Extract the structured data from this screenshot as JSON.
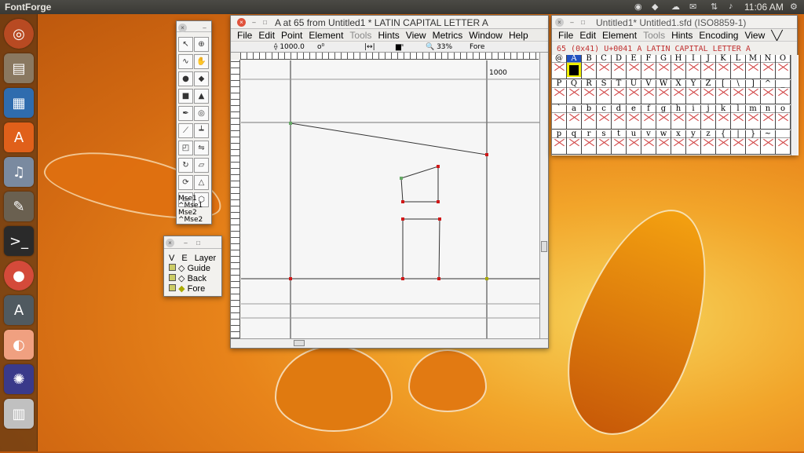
{
  "topbar": {
    "app": "FontForge",
    "clock": "11:06 AM"
  },
  "glyph_window": {
    "title": "A at 65 from Untitled1 * LATIN CAPITAL LETTER A",
    "menu": [
      "File",
      "Edit",
      "Point",
      "Element",
      "Tools",
      "Hints",
      "View",
      "Metrics",
      "Window",
      "Help"
    ],
    "ruler_info": {
      "width": "1000.0",
      "zoom": "33%",
      "layer": "Fore"
    },
    "advance_label": "1000"
  },
  "font_window": {
    "title": "Untitled1* Untitled1.sfd (ISO8859-1)",
    "menu": [
      "File",
      "Edit",
      "Element",
      "Tools",
      "Hints",
      "Encoding",
      "View"
    ],
    "status": "65   (0x41) U+0041  A  LATIN CAPITAL LETTER A",
    "rows": [
      [
        "@",
        "A",
        "B",
        "C",
        "D",
        "E",
        "F",
        "G",
        "H",
        "I",
        "J",
        "K",
        "L",
        "M",
        "N",
        "O"
      ],
      [
        "P",
        "Q",
        "R",
        "S",
        "T",
        "U",
        "V",
        "W",
        "X",
        "Y",
        "Z",
        "[",
        "\\",
        "]",
        "^",
        "_"
      ],
      [
        "`",
        "a",
        "b",
        "c",
        "d",
        "e",
        "f",
        "g",
        "h",
        "i",
        "j",
        "k",
        "l",
        "m",
        "n",
        "o"
      ],
      [
        "p",
        "q",
        "r",
        "s",
        "t",
        "u",
        "v",
        "w",
        "x",
        "y",
        "z",
        "{",
        "|",
        "}",
        "~",
        ""
      ]
    ]
  },
  "tools": {
    "mse": [
      "Mse1",
      "^Mse1",
      "Mse2",
      "^Mse2"
    ]
  },
  "layers": {
    "header": [
      "V",
      "E",
      "Layer"
    ],
    "items": [
      "Guide",
      "Back",
      "Fore"
    ]
  }
}
